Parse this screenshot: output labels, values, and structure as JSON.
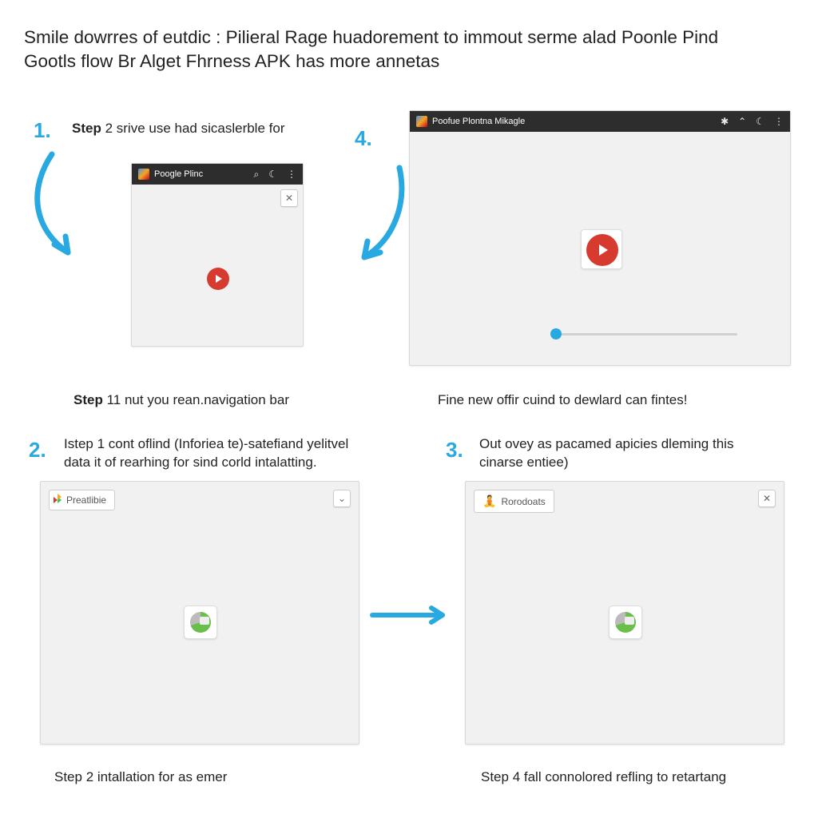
{
  "title": "Smile dowrres of eutdic : Pilieral Rage huadorement to immout serme alad Poonle Pind Gootls flow Br Alget Fhrness APK has more annetas",
  "steps": {
    "s1": {
      "num": "1.",
      "text_prefix": "Step",
      "text_bold": "2",
      "text_rest": " srive use had sicaslerble for"
    },
    "s4": {
      "num": "4."
    },
    "caption_1b": {
      "prefix": "Step",
      "bold": "11",
      "rest": " nut you rean.navigation bar"
    },
    "caption_4b": "Fine new offir cuind to dewlard can fintes!",
    "s2": {
      "num": "2.",
      "text": "Istep 1 cont oflind (Inforiea te)-satefiand yelitvel data it of rearhing for sind corld intalatting."
    },
    "s3": {
      "num": "3.",
      "text": "Out ovey as pacamed apicies dleming this cinarse entiee)"
    },
    "caption_2b": "Step 2 intallation for as emer",
    "caption_3b": "Step 4 fall connolored refling to retartang"
  },
  "panels": {
    "p1": {
      "title": "Poogle Plinc"
    },
    "p4": {
      "title": "Poofue Plontna Mikagle"
    },
    "p2": {
      "tab": "Preatlibie"
    },
    "p3": {
      "tab": "Rorodoats"
    }
  },
  "icons": {
    "search": "⌕",
    "moon": "☾",
    "more": "⋮",
    "snow": "✱",
    "up": "⌃",
    "close": "✕",
    "chev": "⌄"
  }
}
